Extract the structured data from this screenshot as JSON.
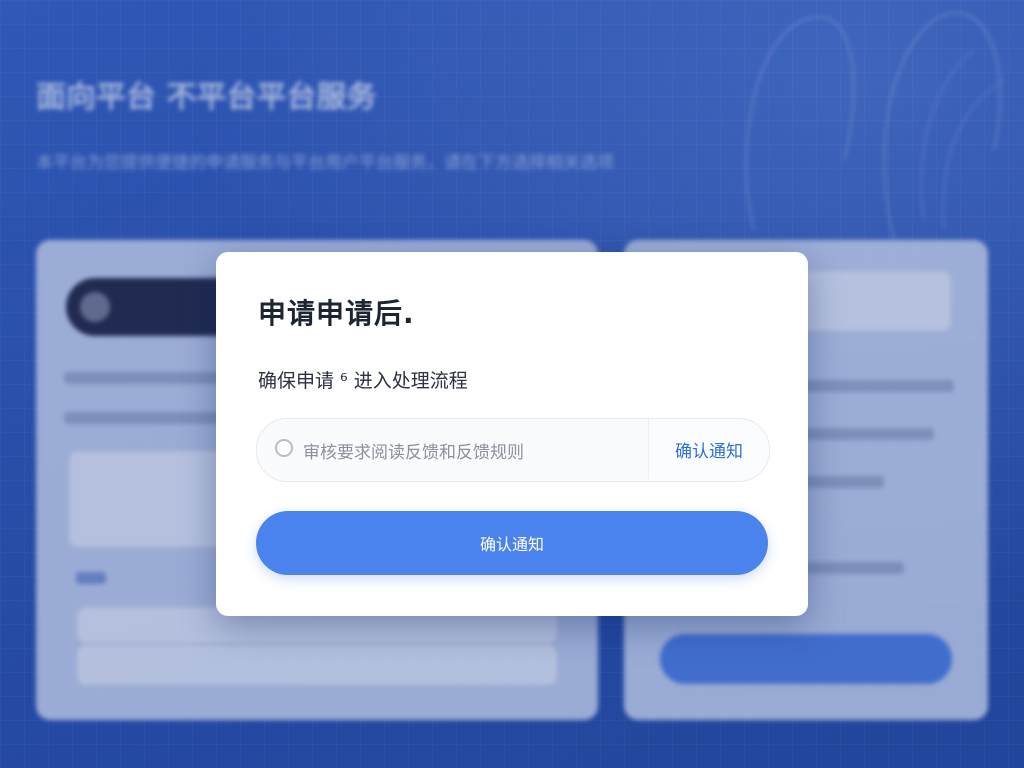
{
  "background": {
    "title": "面向平台 不平台平台服务",
    "subtitle": "本平台为您提供便捷的申请服务与平台用户平台服务，请在下方选择相关选项"
  },
  "modal": {
    "title": "申请申请后.",
    "description": "确保申请 ⁶ 进入处理流程",
    "option_text": "审核要求阅读反馈和反馈规则",
    "option_action": "确认通知",
    "primary_button": "确认通知"
  },
  "colors": {
    "accent": "#4a82ee",
    "link": "#2f6fd8",
    "background": "#2c56b4"
  }
}
